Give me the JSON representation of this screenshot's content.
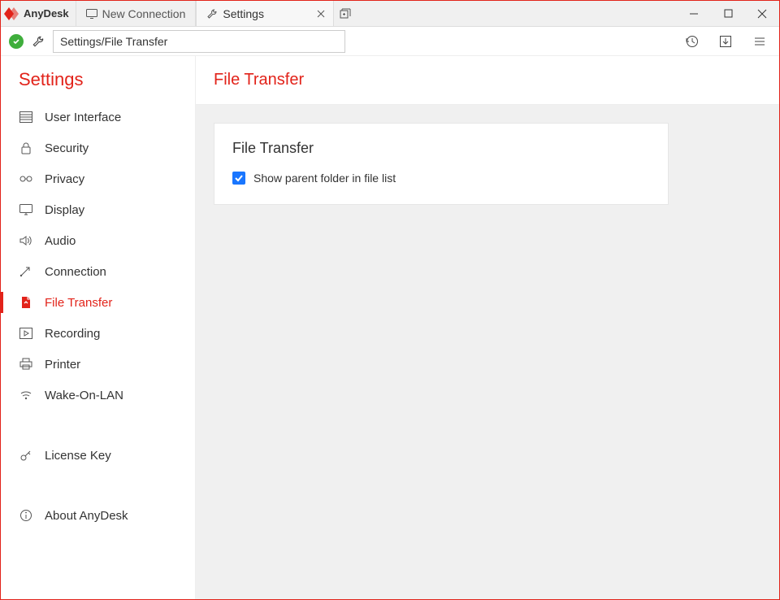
{
  "app": {
    "name": "AnyDesk"
  },
  "tabs": [
    {
      "label": "New Connection",
      "active": false
    },
    {
      "label": "Settings",
      "active": true
    }
  ],
  "address": {
    "value": "Settings/File Transfer"
  },
  "sidebar": {
    "title": "Settings",
    "items": [
      {
        "label": "User Interface",
        "icon": "ui"
      },
      {
        "label": "Security",
        "icon": "lock"
      },
      {
        "label": "Privacy",
        "icon": "glasses"
      },
      {
        "label": "Display",
        "icon": "monitor"
      },
      {
        "label": "Audio",
        "icon": "speaker"
      },
      {
        "label": "Connection",
        "icon": "arrow"
      },
      {
        "label": "File Transfer",
        "icon": "file",
        "active": true
      },
      {
        "label": "Recording",
        "icon": "play"
      },
      {
        "label": "Printer",
        "icon": "printer"
      },
      {
        "label": "Wake-On-LAN",
        "icon": "wifi"
      }
    ],
    "license": {
      "label": "License Key"
    },
    "about": {
      "label": "About AnyDesk"
    }
  },
  "main": {
    "title": "File Transfer",
    "card": {
      "heading": "File Transfer",
      "checkbox_label": "Show parent folder in file list",
      "checkbox_checked": true
    }
  }
}
